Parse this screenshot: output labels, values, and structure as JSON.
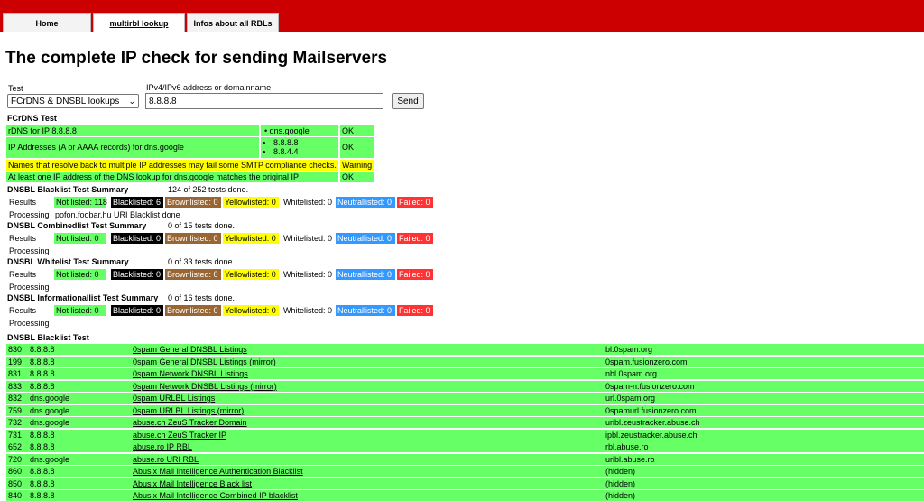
{
  "nav": {
    "home": "Home",
    "multirbl": "multirbl lookup",
    "infos": "Infos about all RBLs"
  },
  "page_title": "The complete IP check for sending Mailservers",
  "form": {
    "test_label": "Test",
    "test_value": "FCrDNS & DNSBL lookups",
    "addr_label": "IPv4/IPv6 address or domainname",
    "addr_value": "8.8.8.8",
    "send": "Send"
  },
  "fcrdns": {
    "title": "FCrDNS Test",
    "rows": [
      {
        "label": "rDNS for IP 8.8.8.8",
        "values": [
          "dns.google"
        ],
        "status": "OK"
      },
      {
        "label": "IP Addresses (A or AAAA records) for dns.google",
        "values": [
          "8.8.8.8",
          "8.8.4.4"
        ],
        "status": "OK"
      },
      {
        "label": "Names that resolve back to multiple IP addresses may fail some SMTP compliance checks.",
        "values": [],
        "status": "Warning"
      },
      {
        "label": "At least one IP address of the DNS lookup for dns.google matches the original IP",
        "values": [],
        "status": "OK"
      }
    ]
  },
  "summaries": [
    {
      "title": "DNSBL Blacklist Test Summary",
      "done": "124 of 252 tests done.",
      "results_label": "Results",
      "not_listed": "Not listed: 118",
      "blacklisted": "Blacklisted: 6",
      "brownlisted": "Brownlisted: 0",
      "yellowlisted": "Yellowlisted: 0",
      "whitelisted": "Whitelisted: 0",
      "neutrallisted": "Neutrallisted: 0",
      "failed": "Failed: 0",
      "processing_label": "Processing",
      "processing_value": "pofon.foobar.hu URI Blacklist done"
    },
    {
      "title": "DNSBL Combinedlist Test Summary",
      "done": "0 of 15 tests done.",
      "results_label": "Results",
      "not_listed": "Not listed: 0",
      "blacklisted": "Blacklisted: 0",
      "brownlisted": "Brownlisted: 0",
      "yellowlisted": "Yellowlisted: 0",
      "whitelisted": "Whitelisted: 0",
      "neutrallisted": "Neutrallisted: 0",
      "failed": "Failed: 0",
      "processing_label": "Processing",
      "processing_value": ""
    },
    {
      "title": "DNSBL Whitelist Test Summary",
      "done": "0 of 33 tests done.",
      "results_label": "Results",
      "not_listed": "Not listed: 0",
      "blacklisted": "Blacklisted: 0",
      "brownlisted": "Brownlisted: 0",
      "yellowlisted": "Yellowlisted: 0",
      "whitelisted": "Whitelisted: 0",
      "neutrallisted": "Neutrallisted: 0",
      "failed": "Failed: 0",
      "processing_label": "Processing",
      "processing_value": ""
    },
    {
      "title": "DNSBL Informationallist Test Summary",
      "done": "0 of 16 tests done.",
      "results_label": "Results",
      "not_listed": "Not listed: 0",
      "blacklisted": "Blacklisted: 0",
      "brownlisted": "Brownlisted: 0",
      "yellowlisted": "Yellowlisted: 0",
      "whitelisted": "Whitelisted: 0",
      "neutrallisted": "Neutrallisted: 0",
      "failed": "Failed: 0",
      "processing_label": "Processing",
      "processing_value": ""
    }
  ],
  "blacklist": {
    "title": "DNSBL Blacklist Test",
    "rows": [
      {
        "id": "830",
        "target": "8.8.8.8",
        "name": "0spam General DNSBL Listings",
        "zone": "bl.0spam.org"
      },
      {
        "id": "199",
        "target": "8.8.8.8",
        "name": "0spam General DNSBL Listings (mirror)",
        "zone": "0spam.fusionzero.com"
      },
      {
        "id": "831",
        "target": "8.8.8.8",
        "name": "0spam Network DNSBL Listings",
        "zone": "nbl.0spam.org"
      },
      {
        "id": "833",
        "target": "8.8.8.8",
        "name": "0spam Network DNSBL Listings (mirror)",
        "zone": "0spam-n.fusionzero.com"
      },
      {
        "id": "832",
        "target": "dns.google",
        "name": "0spam URLBL Listings",
        "zone": "url.0spam.org"
      },
      {
        "id": "759",
        "target": "dns.google",
        "name": "0spam URLBL Listings (mirror)",
        "zone": "0spamurl.fusionzero.com"
      },
      {
        "id": "732",
        "target": "dns.google",
        "name": "abuse.ch ZeuS Tracker Domain",
        "zone": "uribl.zeustracker.abuse.ch"
      },
      {
        "id": "731",
        "target": "8.8.8.8",
        "name": "abuse.ch ZeuS Tracker IP",
        "zone": "ipbl.zeustracker.abuse.ch"
      },
      {
        "id": "652",
        "target": "8.8.8.8",
        "name": "abuse.ro IP RBL",
        "zone": "rbl.abuse.ro"
      },
      {
        "id": "720",
        "target": "dns.google",
        "name": "abuse.ro URI RBL",
        "zone": "uribl.abuse.ro"
      },
      {
        "id": "860",
        "target": "8.8.8.8",
        "name": "Abusix Mail Intelligence Authentication Blacklist",
        "zone": "(hidden)"
      },
      {
        "id": "850",
        "target": "8.8.8.8",
        "name": "Abusix Mail Intelligence Black list",
        "zone": "(hidden)"
      },
      {
        "id": "840",
        "target": "8.8.8.8",
        "name": "Abusix Mail Intelligence Combined IP blacklist",
        "zone": "(hidden)"
      }
    ]
  }
}
